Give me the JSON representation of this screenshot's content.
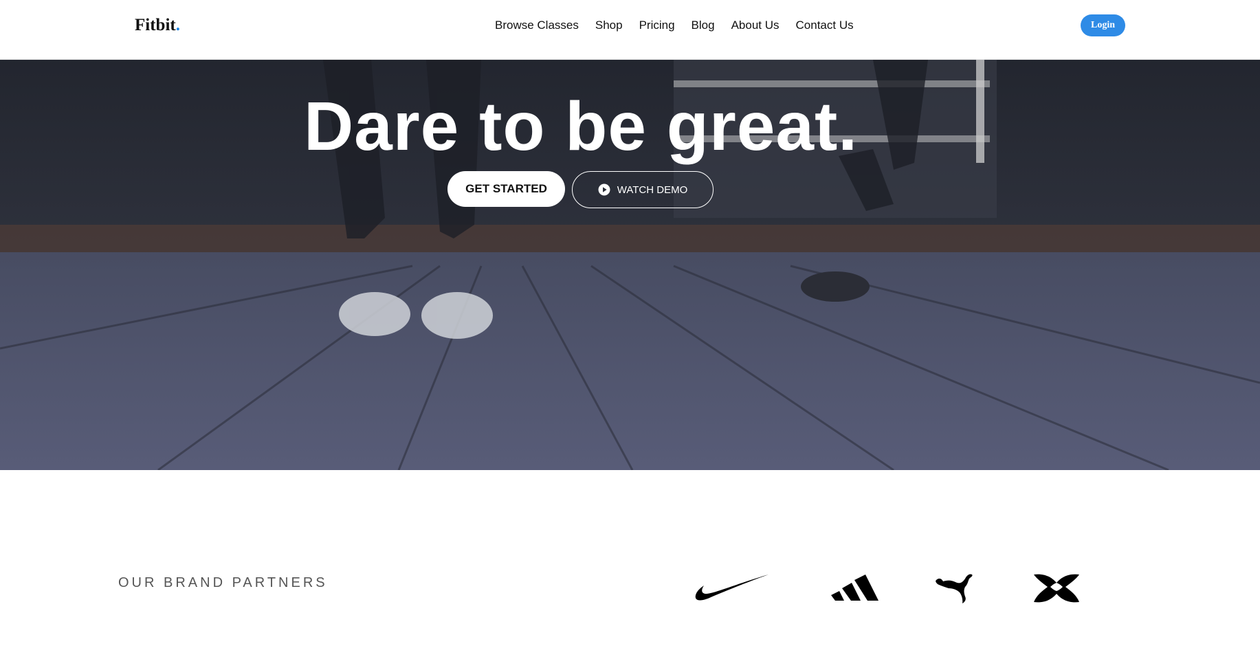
{
  "header": {
    "logo_text": "Fitbit",
    "logo_dot": ".",
    "nav": [
      "Browse Classes",
      "Shop",
      "Pricing",
      "Blog",
      "About Us",
      "Contact Us"
    ],
    "login_label": "Login"
  },
  "hero": {
    "title": "Dare to be great.",
    "primary_cta": "GET STARTED",
    "secondary_cta": "WATCH DEMO",
    "secondary_icon": "play-circle-icon"
  },
  "partners": {
    "label": "OUR BRAND PARTNERS",
    "brands": [
      "nike-logo",
      "adidas-logo",
      "puma-logo",
      "under-armour-logo"
    ]
  },
  "colors": {
    "accent": "#2e8be6",
    "logo_dot": "#1e88e5",
    "hero_overlay": "#343945"
  }
}
